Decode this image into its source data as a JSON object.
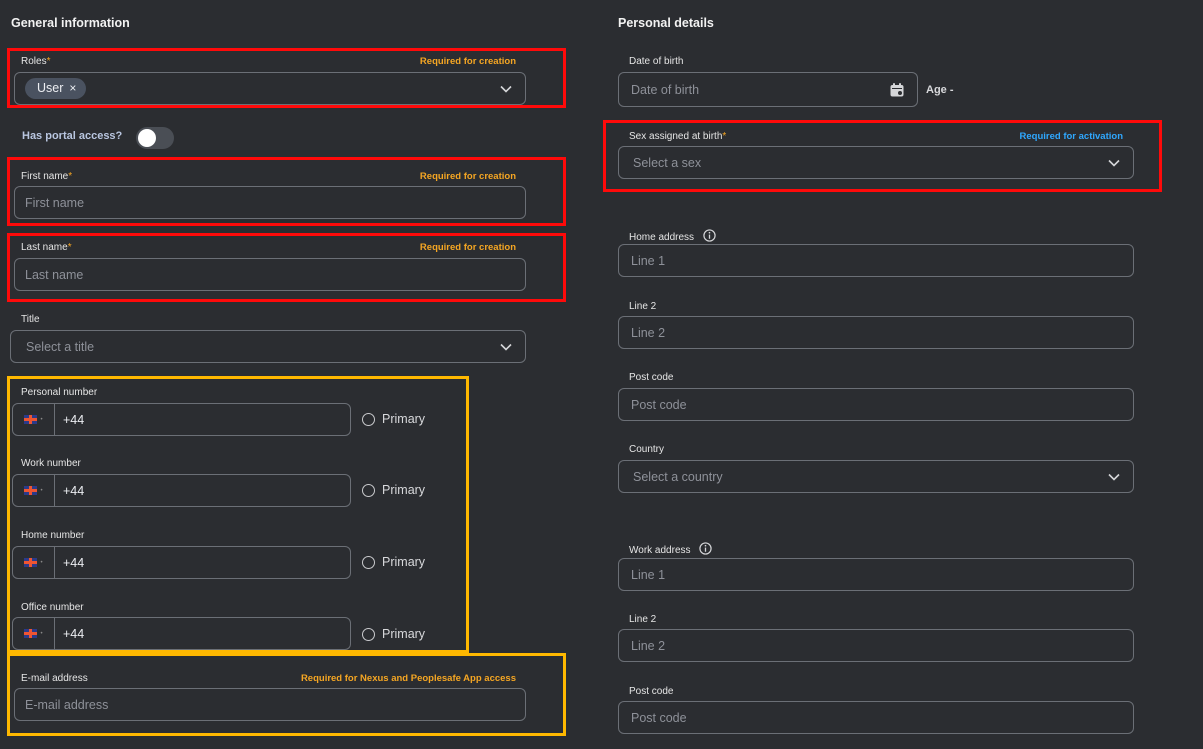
{
  "general": {
    "title": "General information",
    "roles": {
      "label": "Roles",
      "required_mark": "*",
      "hint": "Required for creation",
      "chip": "User",
      "chip_remove": "×"
    },
    "portal": {
      "label": "Has portal access?"
    },
    "first_name": {
      "label": "First name",
      "required_mark": "*",
      "hint": "Required for creation",
      "placeholder": "First name"
    },
    "last_name": {
      "label": "Last name",
      "required_mark": "*",
      "hint": "Required for creation",
      "placeholder": "Last name"
    },
    "title_field": {
      "label": "Title",
      "placeholder": "Select a title"
    },
    "phones": [
      {
        "label": "Personal number",
        "code": "+44",
        "primary": "Primary"
      },
      {
        "label": "Work number",
        "code": "+44",
        "primary": "Primary"
      },
      {
        "label": "Home number",
        "code": "+44",
        "primary": "Primary"
      },
      {
        "label": "Office number",
        "code": "+44",
        "primary": "Primary"
      }
    ],
    "email": {
      "label": "E-mail address",
      "hint": "Required for Nexus and Peoplesafe App access",
      "placeholder": "E-mail address"
    }
  },
  "personal": {
    "title": "Personal details",
    "dob": {
      "label": "Date of birth",
      "placeholder": "Date of birth",
      "age_label": "Age",
      "age_value": "-"
    },
    "sex": {
      "label": "Sex assigned at birth",
      "required_mark": "*",
      "hint": "Required for activation",
      "placeholder": "Select a sex"
    },
    "home_address": {
      "label": "Home address",
      "line1_placeholder": "Line 1",
      "line2_label": "Line 2",
      "line2_placeholder": "Line 2",
      "postcode_label": "Post code",
      "postcode_placeholder": "Post code",
      "country_label": "Country",
      "country_placeholder": "Select a country"
    },
    "work_address": {
      "label": "Work address",
      "line1_placeholder": "Line 1",
      "line2_label": "Line 2",
      "line2_placeholder": "Line 2",
      "postcode_label": "Post code",
      "postcode_placeholder": "Post code"
    }
  },
  "icons": {
    "dropdown": "chevron-down-icon",
    "calendar": "calendar-icon",
    "info": "info-icon",
    "flag": "uk-flag-icon"
  },
  "colors": {
    "background": "#2b2d31",
    "required_orange": "#f5a623",
    "activation_blue": "#2fa8ff",
    "highlight_red": "#ff0a0a",
    "highlight_yellow": "#ffb800"
  }
}
